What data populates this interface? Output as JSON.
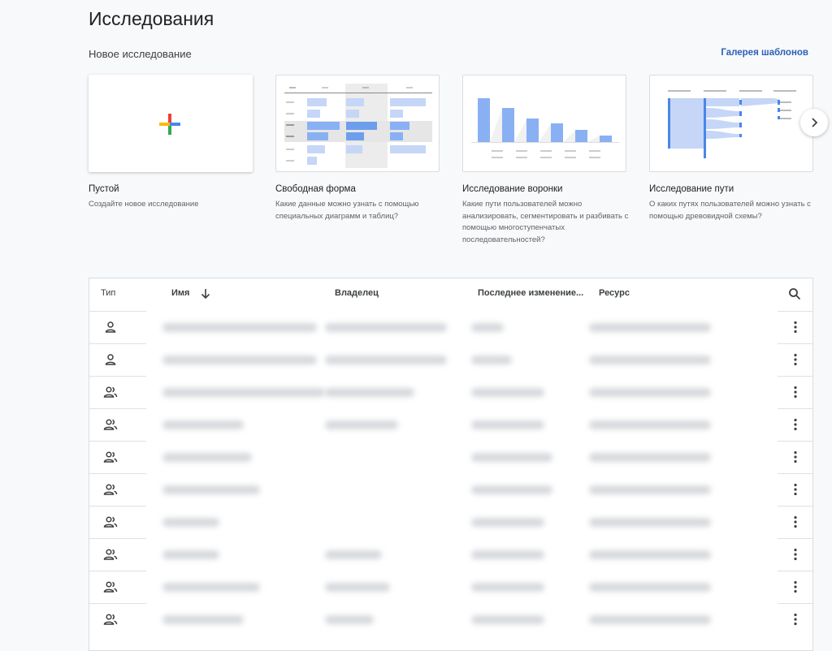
{
  "page": {
    "title": "Исследования"
  },
  "new_section": {
    "title": "Новое исследование",
    "gallery_link": "Галерея шаблонов"
  },
  "templates": [
    {
      "title": "Пустой",
      "description": "Создайте новое исследование",
      "thumb": "blank"
    },
    {
      "title": "Свободная форма",
      "description": "Какие данные можно узнать с помощью специальных диаграмм и таблиц?",
      "thumb": "table"
    },
    {
      "title": "Исследование воронки",
      "description": "Какие пути пользователей можно анализировать, сегментировать и разбивать с помощью многоступенчатых последовательностей?",
      "thumb": "funnel"
    },
    {
      "title": "Исследование пути",
      "description": "О каких путях пользователей можно узнать с помощью древовидной схемы?",
      "thumb": "path"
    }
  ],
  "table": {
    "columns": {
      "type": "Тип",
      "name": "Имя",
      "owner": "Владелец",
      "modified": "Последнее изменение...",
      "resource": "Ресурс"
    },
    "rows": [
      {
        "type": "person"
      },
      {
        "type": "person"
      },
      {
        "type": "group"
      },
      {
        "type": "group"
      },
      {
        "type": "group"
      },
      {
        "type": "group"
      },
      {
        "type": "group"
      },
      {
        "type": "group"
      },
      {
        "type": "group"
      },
      {
        "type": "group"
      }
    ]
  },
  "icons": {
    "sort": "arrow-down-icon",
    "search": "search-icon",
    "next": "chevron-right-icon",
    "row_menu": "more-vert-icon",
    "type_person": "person-icon",
    "type_group": "group-icon"
  },
  "colors": {
    "accent": "#4285f4",
    "link": "#2b5fb8"
  }
}
